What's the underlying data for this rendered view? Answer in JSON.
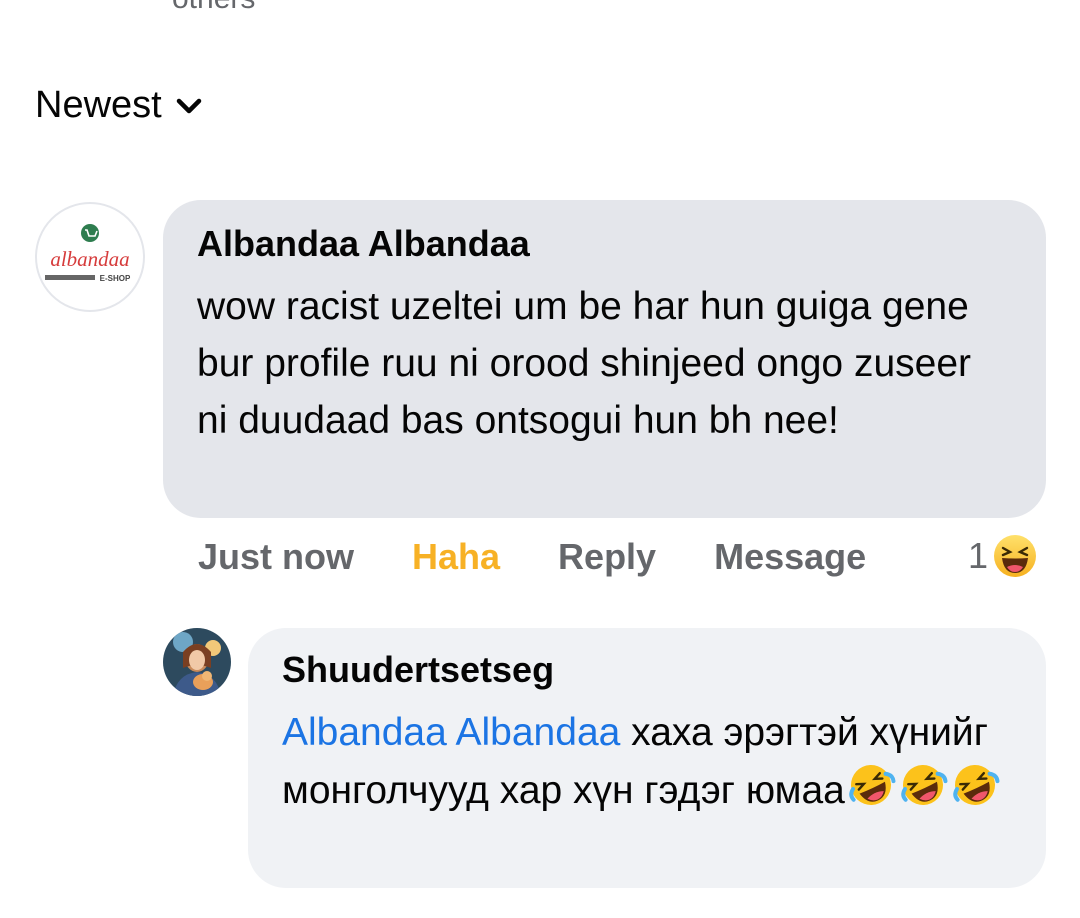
{
  "top_clip_text": "others",
  "sort": {
    "label": "Newest"
  },
  "comment": {
    "author": "Albandaa Albandaa",
    "avatar_text": "albandaa",
    "avatar_subtext": "E-SHOP",
    "text": "wow racist uzeltei um be har hun guiga gene bur profile ruu ni orood shinjeed ongo zuseer ni duudaad bas ontsogui hun bh nee!",
    "time": "Just now",
    "reaction_label": "Haha",
    "reply_label": "Reply",
    "message_label": "Message",
    "reaction_count": "1",
    "reaction_icon": "haha-emoji-icon"
  },
  "reply": {
    "author": "Shuudertsetseg",
    "mention": "Albandaa Albandaa",
    "text": " хаха эрэгтэй хүнийг монголчууд хар хүн гэдэг юмаа",
    "emojis": [
      "rolling-on-floor-laughing-icon",
      "rolling-on-floor-laughing-icon",
      "rolling-on-floor-laughing-icon"
    ]
  },
  "colors": {
    "accent_link": "#1b74e4",
    "haha": "#f7b125",
    "muted": "#65676b",
    "bubble": "#e4e6eb",
    "bubble_reply": "#f0f2f5"
  }
}
